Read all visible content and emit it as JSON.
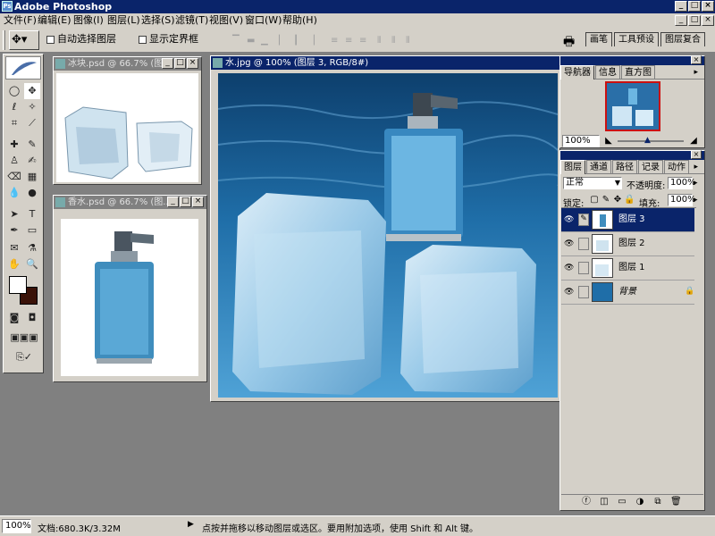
{
  "app": {
    "title": "Adobe Photoshop",
    "logo_icon": "photoshop-logo-icon"
  },
  "window_controls": {
    "minimize": "_",
    "maximize": "□",
    "close": "×"
  },
  "menu": [
    "文件(F)",
    "编辑(E)",
    "图像(I)",
    "图层(L)",
    "选择(S)",
    "滤镜(T)",
    "视图(V)",
    "窗口(W)",
    "帮助(H)"
  ],
  "options": {
    "move_tool_icon": "move-tool-icon",
    "auto_select": "自动选择图层",
    "show_bounds": "显示定界框"
  },
  "palette_well": [
    "画笔",
    "工具预设",
    "图层复合"
  ],
  "documents": {
    "ice": {
      "title": "冰块.psd @ 66.7% (图..."
    },
    "perfume": {
      "title": "香水.psd @ 66.7% (图..."
    },
    "water": {
      "title": "水.jpg @ 100% (图层 3, RGB/8#)"
    }
  },
  "navigator": {
    "tabs": [
      "导航器",
      "信息",
      "直方图"
    ],
    "zoom": "100%"
  },
  "layers_panel": {
    "tabs": [
      "图层",
      "通道",
      "路径",
      "记录",
      "动作"
    ],
    "blend_mode": "正常",
    "opacity_label": "不透明度:",
    "opacity_value": "100%",
    "lock_label": "锁定:",
    "fill_label": "填充:",
    "fill_value": "100%",
    "layers": [
      {
        "name": "图层 3",
        "selected": true
      },
      {
        "name": "图层 2",
        "selected": false
      },
      {
        "name": "图层 1",
        "selected": false
      },
      {
        "name": "背景",
        "selected": false
      }
    ]
  },
  "status": {
    "zoom": "100%",
    "doc": "文档:680.3K/3.32M",
    "hint": "点按并拖移以移动图层或选区。要用附加选项，使用 Shift 和 Alt 键。"
  },
  "colors": {
    "accent": "#0a246a",
    "chrome": "#d4d0c8",
    "workspace": "#808080"
  }
}
